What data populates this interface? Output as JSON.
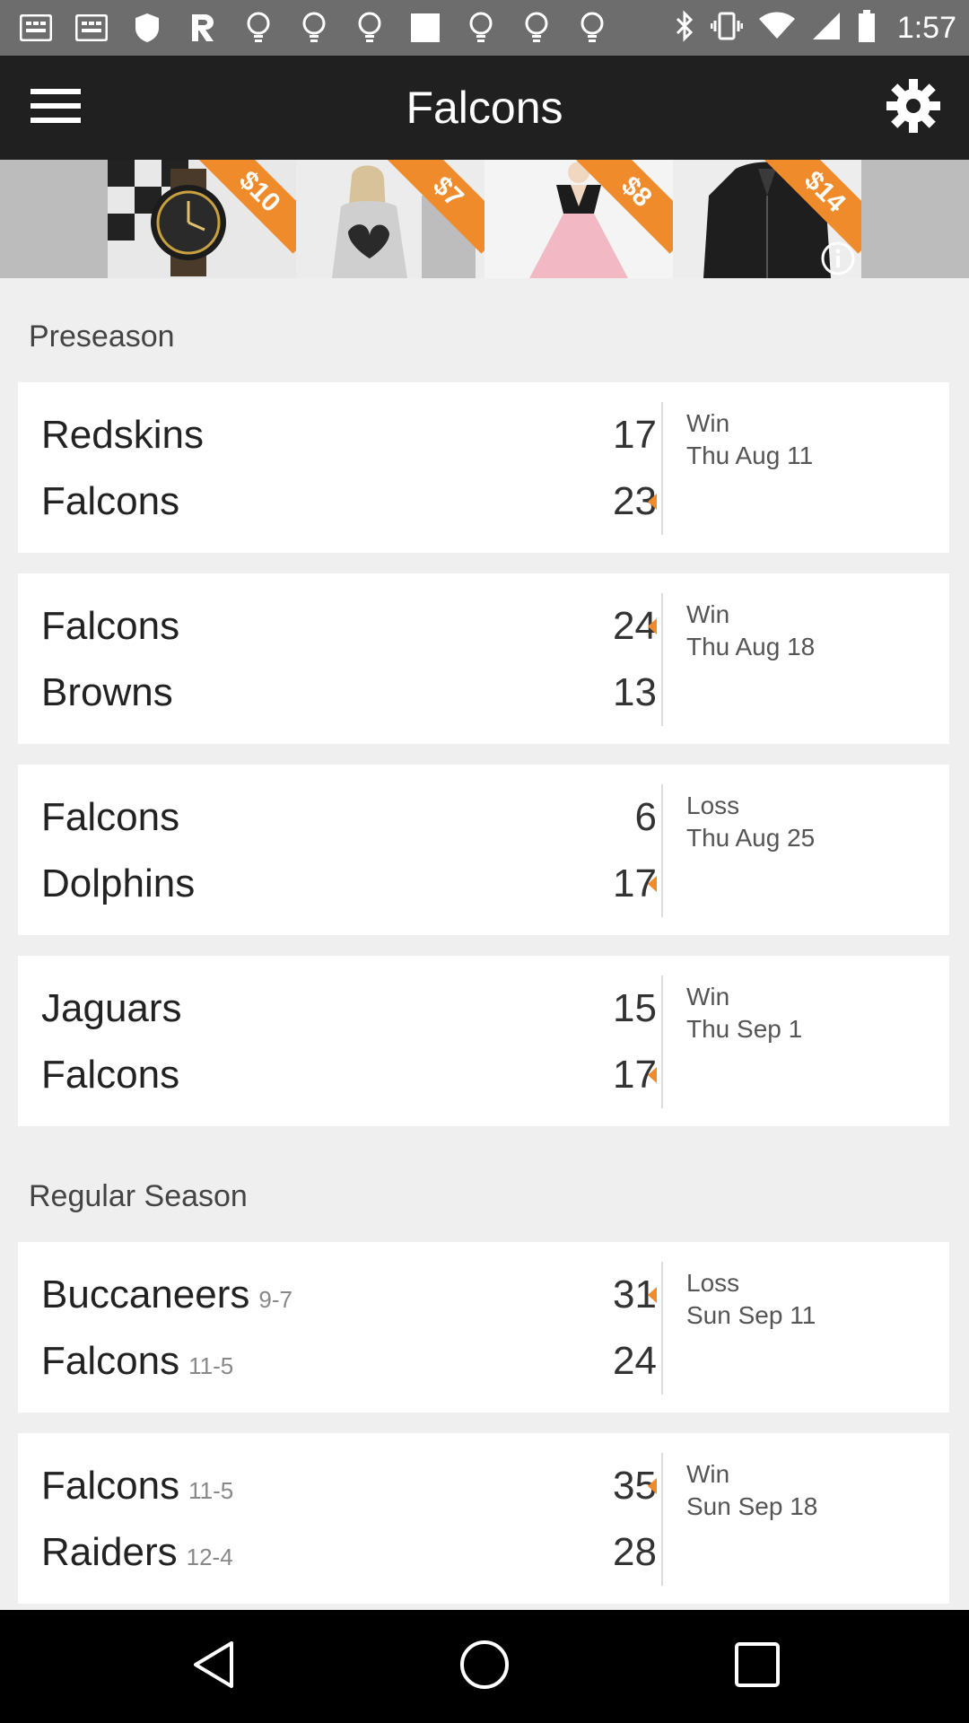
{
  "status_bar": {
    "time": "1:57",
    "left_icons": [
      "notification-icon",
      "notification-icon",
      "shield-icon",
      "reddit-icon",
      "lightbulb-icon",
      "lightbulb-icon",
      "lightbulb-icon",
      "square-icon",
      "lightbulb-icon",
      "lightbulb-icon",
      "lightbulb-icon"
    ],
    "right_icons": [
      "bluetooth-icon",
      "vibrate-icon",
      "wifi-icon",
      "signal-icon",
      "battery-icon"
    ]
  },
  "app_bar": {
    "title": "Falcons",
    "menu_icon": "menu-icon",
    "settings_icon": "gear-icon"
  },
  "ad": {
    "tags": [
      "$10",
      "$7",
      "$8",
      "$14"
    ],
    "info_icon": "info-icon"
  },
  "sections": [
    {
      "title": "Preseason",
      "games": [
        {
          "home": "Redskins",
          "home_record": "",
          "home_score": "17",
          "away": "Falcons",
          "away_record": "",
          "away_score": "23",
          "winner": "bottom",
          "result": "Win",
          "date": "Thu Aug 11"
        },
        {
          "home": "Falcons",
          "home_record": "",
          "home_score": "24",
          "away": "Browns",
          "away_record": "",
          "away_score": "13",
          "winner": "top",
          "result": "Win",
          "date": "Thu Aug 18"
        },
        {
          "home": "Falcons",
          "home_record": "",
          "home_score": "6",
          "away": "Dolphins",
          "away_record": "",
          "away_score": "17",
          "winner": "bottom",
          "result": "Loss",
          "date": "Thu Aug 25"
        },
        {
          "home": "Jaguars",
          "home_record": "",
          "home_score": "15",
          "away": "Falcons",
          "away_record": "",
          "away_score": "17",
          "winner": "bottom",
          "result": "Win",
          "date": "Thu Sep 1"
        }
      ]
    },
    {
      "title": "Regular Season",
      "games": [
        {
          "home": "Buccaneers",
          "home_record": "9-7",
          "home_score": "31",
          "away": "Falcons",
          "away_record": "11-5",
          "away_score": "24",
          "winner": "top",
          "result": "Loss",
          "date": "Sun Sep 11"
        },
        {
          "home": "Falcons",
          "home_record": "11-5",
          "home_score": "35",
          "away": "Raiders",
          "away_record": "12-4",
          "away_score": "28",
          "winner": "top",
          "result": "Win",
          "date": "Sun Sep 18"
        }
      ]
    }
  ],
  "nav_bar": {
    "back_icon": "back-icon",
    "home_icon": "home-icon",
    "recents_icon": "recents-icon"
  },
  "colors": {
    "accent": "#f08b2c",
    "app_bar": "#202020",
    "status_bar": "#6d6d6d",
    "background": "#efefef"
  }
}
